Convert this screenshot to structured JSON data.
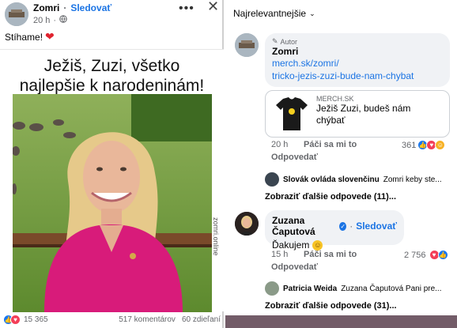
{
  "post": {
    "author": "Zomri",
    "separator": "·",
    "follow": "Sledovať",
    "time": "20 h",
    "visibility_icon": "globe-icon",
    "menu_icon": "more-dots-icon",
    "close_icon": "close-icon",
    "caption": "Stíhame!",
    "caption_emoji": "heart-emoji",
    "headline_line1": "Ježiš, Zuzi, všetko",
    "headline_line2": "najlepšie k narodeninám!",
    "watermark": "zomri.online",
    "reactions_count": "15 365",
    "comments_count": "517 komentárov",
    "shares_count": "60 zdieľaní"
  },
  "comments": {
    "sort_label": "Najrelevantnejšie",
    "first": {
      "badge": "Autor",
      "author": "Zomri",
      "link_line1": "merch.sk/zomri/",
      "link_line2": "tricko-jezis-zuzi-bude-nam-chybat",
      "card_site": "MERCH.SK",
      "card_title_line1": "Ježiš Zuzi, budeš nám",
      "card_title_line2": "chýbať",
      "time": "20 h",
      "like": "Páči sa mi to",
      "reply": "Odpovedať",
      "reactions": "361"
    },
    "first_reply": {
      "author": "Slovák ovláda slovenčinu",
      "text": "Zomri keby ste..."
    },
    "first_more": "Zobraziť ďalšie odpovede (11)...",
    "second": {
      "author": "Zuzana Čaputová",
      "follow": "Sledovať",
      "text": "Ďakujem",
      "time": "15 h",
      "like": "Páči sa mi to",
      "reply": "Odpovedať",
      "reactions": "2 756"
    },
    "second_reply": {
      "author": "Patricia Weida",
      "text": "Zuzana Čaputová Pani pre..."
    },
    "second_more": "Zobraziť ďalšie odpovede (31)..."
  },
  "colors": {
    "link": "#1b74e4",
    "bubble": "#f0f2f5",
    "like_blue": "#1877f2",
    "love_red": "#f33e58",
    "shirt": "#d81b7a"
  }
}
